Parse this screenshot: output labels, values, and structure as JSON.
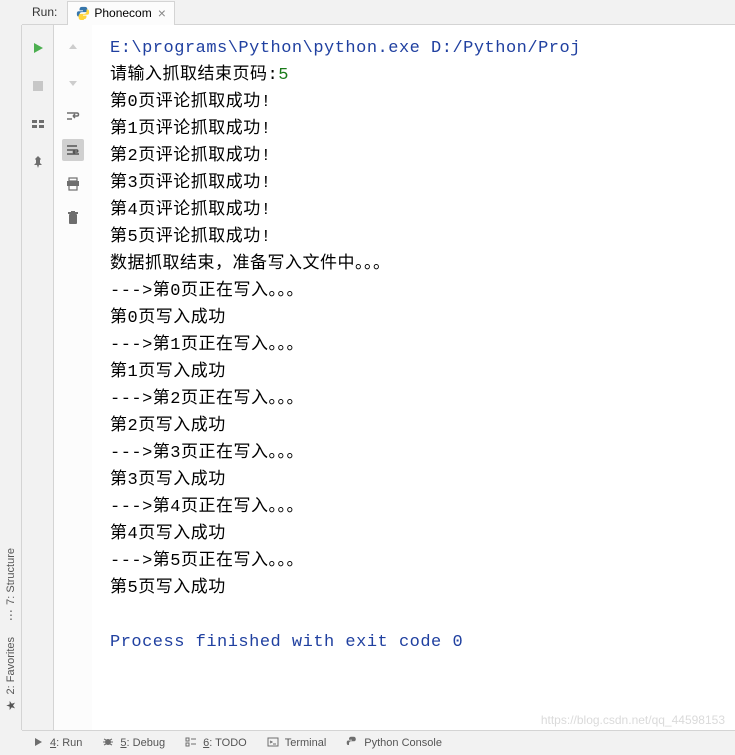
{
  "topbar": {
    "run_label": "Run:",
    "file_name": "Phonecom"
  },
  "sidebar_tabs": {
    "structure": "7: Structure",
    "favorites": "2: Favorites"
  },
  "console": {
    "cmd": "E:\\programs\\Python\\python.exe D:/Python/Proj",
    "prompt": "请输入抓取结束页码:",
    "input_value": "5",
    "lines": [
      "第0页评论抓取成功!",
      "第1页评论抓取成功!",
      "第2页评论抓取成功!",
      "第3页评论抓取成功!",
      "第4页评论抓取成功!",
      "第5页评论抓取成功!",
      "数据抓取结束，准备写入文件中。。。",
      "--->第0页正在写入。。。",
      "第0页写入成功",
      "--->第1页正在写入。。。",
      "第1页写入成功",
      "--->第2页正在写入。。。",
      "第2页写入成功",
      "--->第3页正在写入。。。",
      "第3页写入成功",
      "--->第4页正在写入。。。",
      "第4页写入成功",
      "--->第5页正在写入。。。",
      "第5页写入成功"
    ],
    "finished": "Process finished with exit code 0"
  },
  "bottombar": {
    "run": "4: Run",
    "debug": "5: Debug",
    "todo": "6: TODO",
    "terminal": "Terminal",
    "python_console": "Python Console"
  },
  "watermark": "https://blog.csdn.net/qq_44598153"
}
